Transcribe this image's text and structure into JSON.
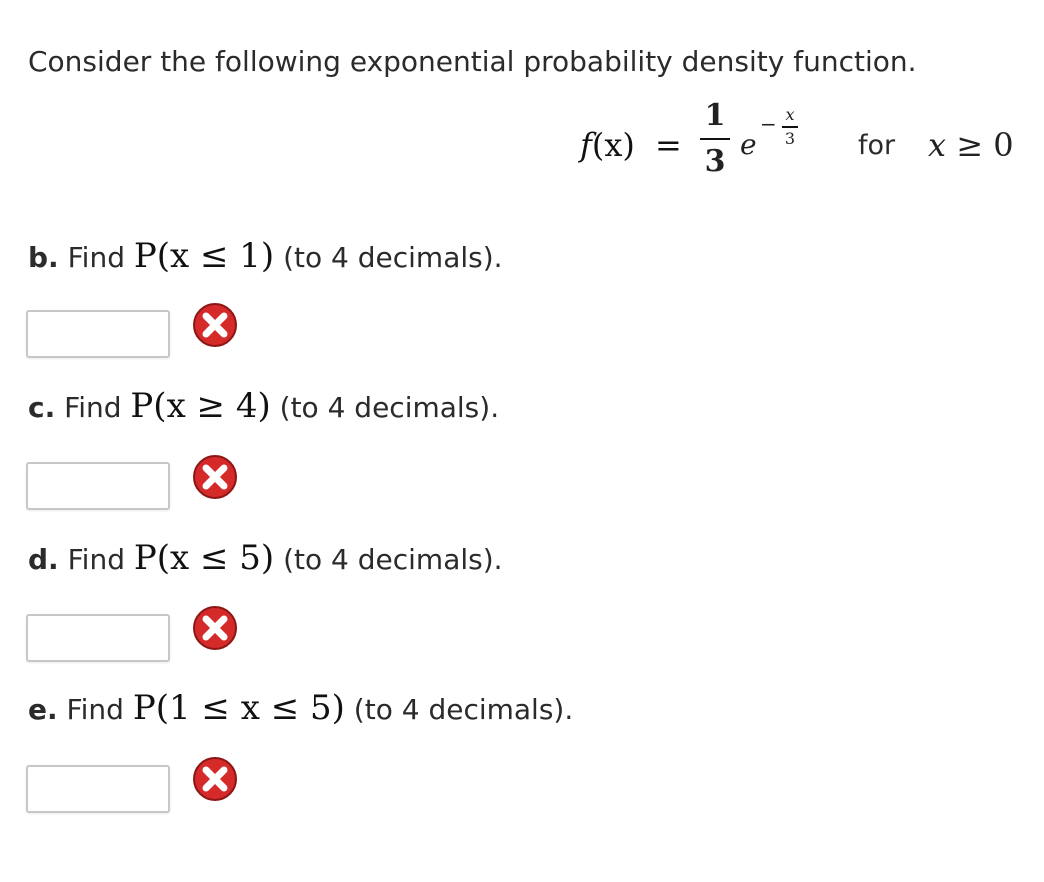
{
  "intro": "Consider the following exponential probability density function.",
  "formula": {
    "lhs_f": "f",
    "lhs_arg": "(x)",
    "equals": "=",
    "frac_num": "1",
    "frac_den": "3",
    "base": "e",
    "exp_minus": "−",
    "exp_num": "x",
    "exp_den": "3",
    "for_label": "for",
    "cond_var": "x",
    "cond_rest": " ≥ 0"
  },
  "questions": [
    {
      "letter": "b.",
      "prefix": "Find ",
      "math": "P(x ≤ 1)",
      "suffix": " (to 4 decimals).",
      "answer": "",
      "status": "incorrect-icon"
    },
    {
      "letter": "c.",
      "prefix": "Find ",
      "math": "P(x ≥ 4)",
      "suffix": " (to 4 decimals).",
      "answer": "",
      "status": "incorrect-icon"
    },
    {
      "letter": "d.",
      "prefix": "Find ",
      "math": "P(x ≤ 5)",
      "suffix": " (to 4 decimals).",
      "answer": "",
      "status": "incorrect-icon"
    },
    {
      "letter": "e.",
      "prefix": "Find ",
      "math": "P(1 ≤ x ≤ 5)",
      "suffix": " (to 4 decimals).",
      "answer": "",
      "status": "incorrect-icon"
    }
  ],
  "colors": {
    "incorrect": "#cc2222",
    "input_border": "#c7c7c7"
  }
}
